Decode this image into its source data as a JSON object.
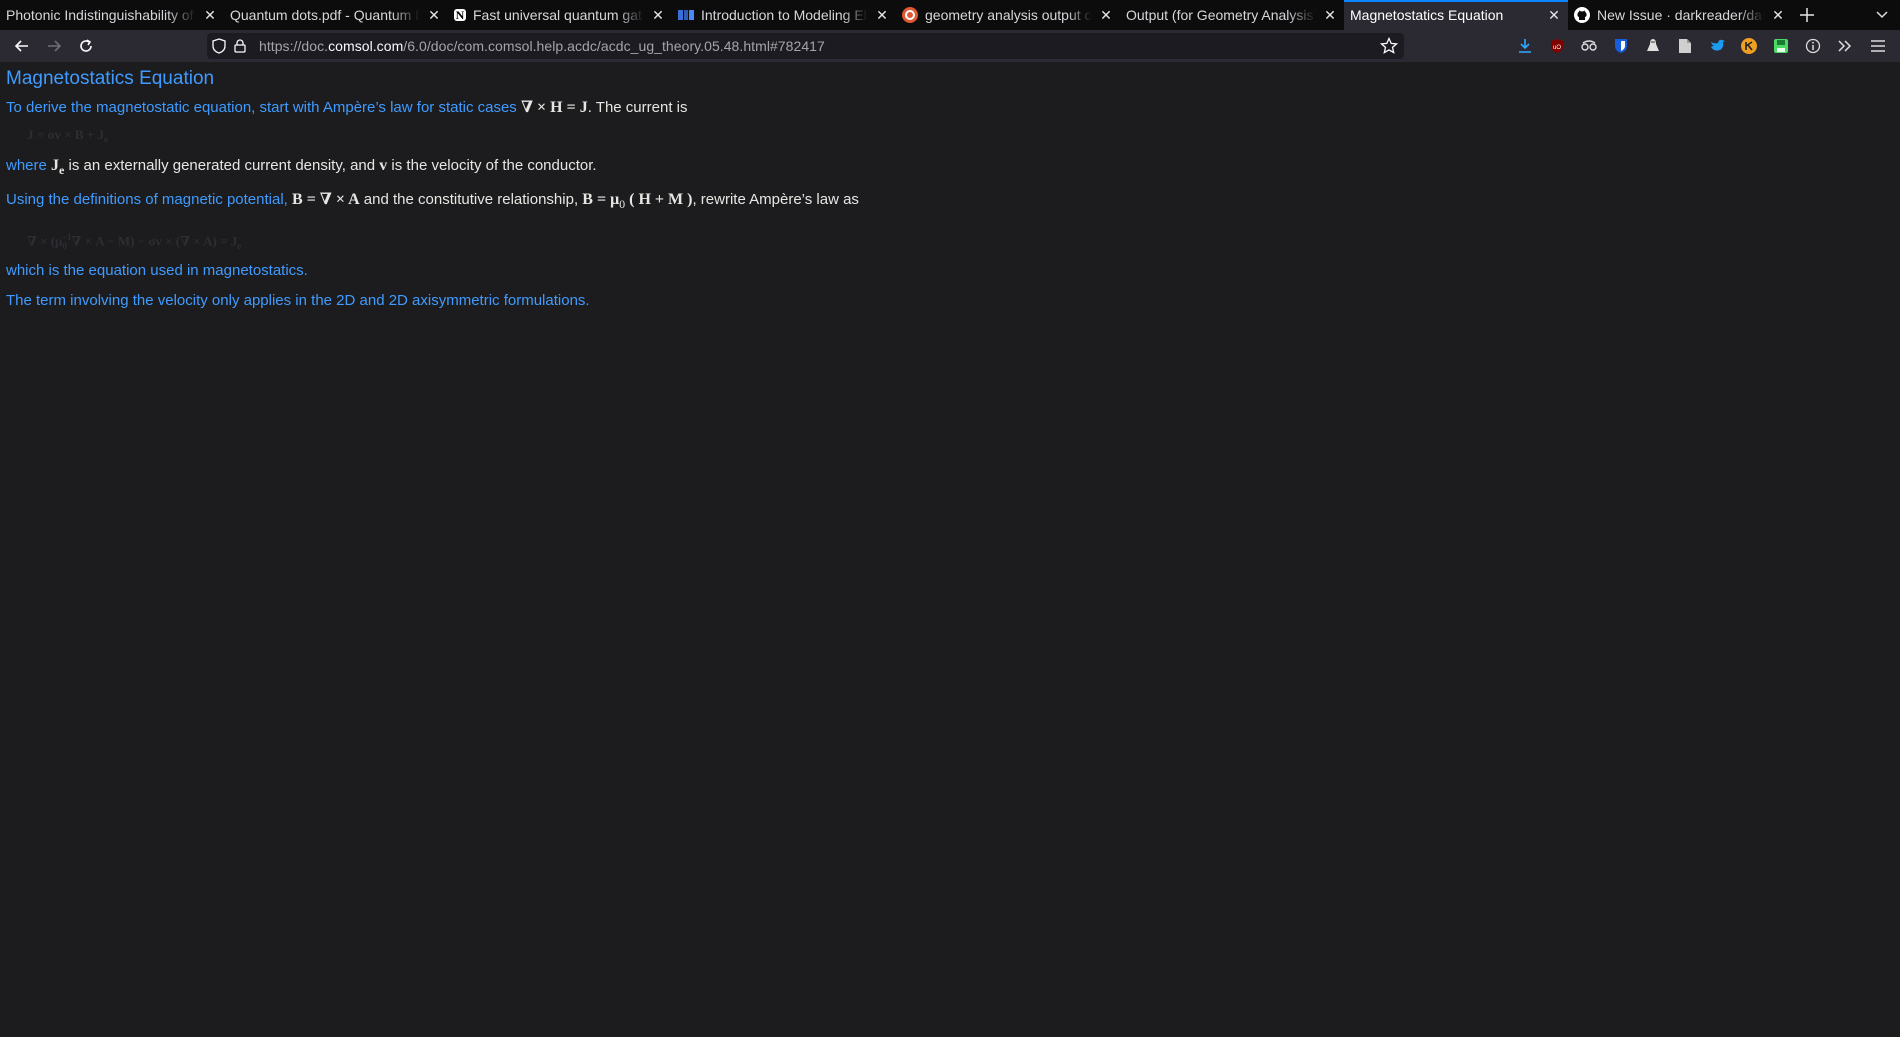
{
  "browser": {
    "tabs": [
      {
        "title": "Photonic Indistinguishability of I",
        "favicon": "none",
        "active": false
      },
      {
        "title": "Quantum dots.pdf - Quantum Do",
        "favicon": "none",
        "active": false
      },
      {
        "title": "Fast universal quantum gate",
        "favicon": "notion-icon",
        "active": false
      },
      {
        "title": "Introduction to Modeling Ele",
        "favicon": "comsol-icon",
        "active": false
      },
      {
        "title": "geometry analysis output co",
        "favicon": "duckduckgo-icon",
        "active": false
      },
      {
        "title": "Output (for Geometry Analysis)",
        "favicon": "none",
        "active": false
      },
      {
        "title": "Magnetostatics Equation",
        "favicon": "none",
        "active": true
      },
      {
        "title": "New Issue · darkreader/dark",
        "favicon": "github-icon",
        "active": false
      }
    ],
    "url": {
      "prefix": "https://doc.",
      "host": "comsol.com",
      "path": "/6.0/doc/com.comsol.help.acdc/acdc_ug_theory.05.48.html#782417"
    },
    "colors": {
      "accent": "#0a84ff",
      "tabbar_bg": "#0c0c0d",
      "toolbar_bg": "#2b2a33",
      "link": "#3f9bff"
    }
  },
  "page": {
    "title": "Magnetostatics Equation",
    "p1": {
      "text": "To derive the magnetostatic equation, start with Ampère’s law for static cases ",
      "math": "∇ × H = J",
      "tail": ". The current is"
    },
    "eq1": "J = σv × B + J",
    "eq1_sub": "e",
    "p2": {
      "lead": "where ",
      "math_main": "J",
      "math_sub": "e",
      "mid": " is an externally generated current density, and ",
      "math_v": "v",
      "tail": " is the velocity of the conductor."
    },
    "p3": {
      "lead": "Using the definitions of magnetic potential, ",
      "math1": "B = ∇ × A",
      "mid": " and the constitutive relationship, ",
      "math2": "B = μ",
      "math2_sub": "0",
      "math2_rest": " ( H + M )",
      "tail": ", rewrite Ampère’s law as"
    },
    "eq2": {
      "pre": "∇ × (μ",
      "sub": "0",
      "sup": "−1",
      "rest": "∇ × A − M) − σv × (∇ × A) = J",
      "end_sub": "e"
    },
    "p4": "which is the equation used in magnetostatics.",
    "p5": "The term involving the velocity only applies in the 2D and 2D axisymmetric formulations."
  }
}
